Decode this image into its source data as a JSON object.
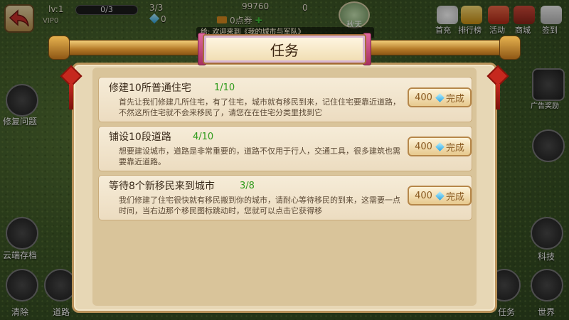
{
  "hud": {
    "level": "lv:1",
    "exp": "0/3",
    "pop": "3/3",
    "gems": "0",
    "coins": "99760",
    "points": "0点券",
    "score": "0",
    "season": "秋天",
    "vip": "VIP0"
  },
  "top_buttons": [
    {
      "label": "首充"
    },
    {
      "label": "排行榜"
    },
    {
      "label": "活动"
    },
    {
      "label": "商城"
    },
    {
      "label": "签到"
    }
  ],
  "side_buttons": {
    "repair": "修复问题",
    "cloud": "云端存档",
    "clear": "清除",
    "road": "道路",
    "ad": "广告奖励",
    "tech": "科技",
    "task": "任务",
    "world": "世界"
  },
  "ticker": "给: 欢迎来到《我的城市与军队》",
  "dialog": {
    "title": "任务",
    "tasks": [
      {
        "title": "修建10所普通住宅",
        "progress": "1/10",
        "desc": "首先让我们修建几所住宅，有了住宅，城市就有移民到来，记住住宅要靠近道路，不然这所住宅就不会来移民了，请您在在住宅分类里找到它",
        "reward": "400",
        "btn": "完成"
      },
      {
        "title": "铺设10段道路",
        "progress": "4/10",
        "desc": "想要建设城市，道路是非常重要的，道路不仅用于行人，交通工具，很多建筑也需要靠近道路。",
        "reward": "400",
        "btn": "完成"
      },
      {
        "title": "等待8个新移民来到城市",
        "progress": "3/8",
        "desc": "我们修建了住宅很快就有移民搬到你的城市，请耐心等待移民的到来，这需要一点时间，当右边那个移民图标跳动时，您就可以点击它获得移",
        "reward": "400",
        "btn": "完成"
      }
    ]
  },
  "colors": {
    "progress": "#2e9b1b",
    "gold": "#b57a28",
    "accent": "#c6281e"
  }
}
